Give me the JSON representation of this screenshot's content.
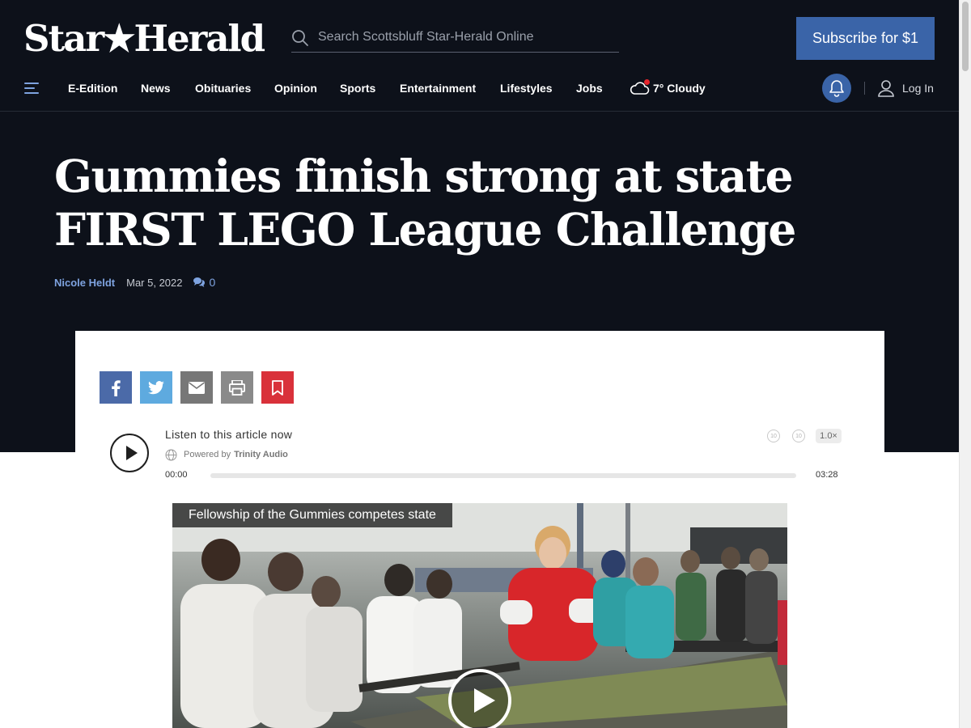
{
  "header": {
    "logo_text": "Star★Herald",
    "search_placeholder": "Search Scottsbluff Star-Herald Online",
    "subscribe_label": "Subscribe for $1"
  },
  "nav": {
    "items": [
      "E-Edition",
      "News",
      "Obituaries",
      "Opinion",
      "Sports",
      "Entertainment",
      "Lifestyles",
      "Jobs"
    ],
    "weather": "7° Cloudy",
    "login_label": "Log In"
  },
  "article": {
    "headline": "Gummies finish strong at state FIRST LEGO League Challenge",
    "author": "Nicole Heldt",
    "date": "Mar 5, 2022",
    "comment_count": "0"
  },
  "share": [
    "facebook-icon",
    "twitter-icon",
    "email-icon",
    "print-icon",
    "bookmark-icon"
  ],
  "audio": {
    "title": "Listen to this article now",
    "powered_by": "Powered by",
    "brand": "Trinity Audio",
    "current_time": "00:00",
    "total_time": "03:28",
    "speed": "1.0×",
    "skip_back": "10",
    "skip_forward": "10",
    "progress": 0
  },
  "video": {
    "caption": "Fellowship of the Gummies competes state"
  },
  "colors": {
    "header_bg": "#0d111a",
    "accent": "#3a64a8",
    "link": "#7ea3e0",
    "facebook": "#4b6aa8",
    "twitter": "#5eaadf",
    "email": "#777777",
    "print": "#8a8a8a",
    "bookmark": "#d9313a"
  }
}
